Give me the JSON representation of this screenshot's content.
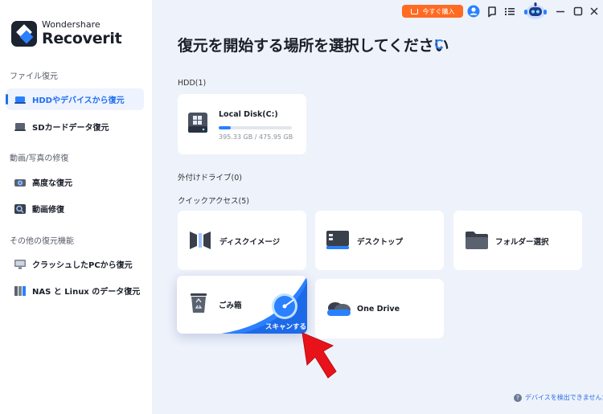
{
  "app": {
    "brand": "Wondershare",
    "product": "Recoverit"
  },
  "sidebar": {
    "sections": [
      {
        "title": "ファイル復元",
        "items": [
          {
            "label": "HDDやデバイスから復元",
            "icon": "hdd-icon",
            "active": true
          },
          {
            "label": "SDカードデータ復元",
            "icon": "sd-card-icon",
            "active": false
          }
        ]
      },
      {
        "title": "動画/写真の修復",
        "items": [
          {
            "label": "高度な復元",
            "icon": "camera-icon",
            "active": false
          },
          {
            "label": "動画修復",
            "icon": "video-repair-icon",
            "active": false
          }
        ]
      },
      {
        "title": "その他の復元機能",
        "items": [
          {
            "label": "クラッシュしたPCから復元",
            "icon": "monitor-icon",
            "active": false
          },
          {
            "label": "NAS と Linux のデータ復元",
            "icon": "nas-icon",
            "active": false
          }
        ]
      }
    ]
  },
  "topbar": {
    "buy_label": "今すぐ購入"
  },
  "main": {
    "title": "復元を開始する場所を選択してください",
    "hdd_section": "HDD(1)",
    "disk": {
      "name": "Local Disk(C:)",
      "usage": "395.33 GB / 475.95 GB",
      "used_fraction": 0.17
    },
    "external_section": "外付けドライブ(0)",
    "quick_section": "クイックアクセス(5)",
    "quick_items": [
      {
        "label": "ディスクイメージ",
        "icon": "disk-image-icon"
      },
      {
        "label": "デスクトップ",
        "icon": "desktop-icon"
      },
      {
        "label": "フォルダー選択",
        "icon": "folder-icon"
      },
      {
        "label": "ごみ箱",
        "icon": "recycle-bin-icon"
      },
      {
        "label": "One Drive",
        "icon": "onedrive-icon"
      }
    ],
    "scan_label": "スキャンする",
    "help_text": "デバイスを検出できませんか？"
  },
  "colors": {
    "accent": "#2a80ff",
    "buy": "#ff6b22",
    "sidebar_active_bg": "#eef3ff",
    "bg": "#eef2fb"
  }
}
